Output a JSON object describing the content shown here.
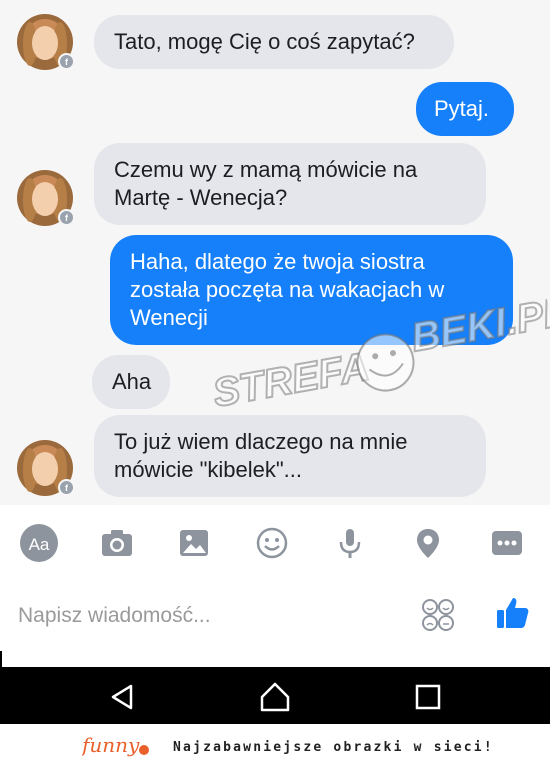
{
  "messages": [
    {
      "side": "in",
      "text": "Tato, mogę Cię o coś zapytać?"
    },
    {
      "side": "out",
      "text": "Pytaj."
    },
    {
      "side": "in",
      "text": "Czemu wy z mamą mówicie na Martę - Wenecja?"
    },
    {
      "side": "out",
      "text": "Haha, dlatego że twoja siostra została poczęta na wakacjach w Wenecji"
    },
    {
      "side": "in",
      "text": "Aha"
    },
    {
      "side": "in",
      "text": "To już wiem dlaczego na mnie mówicie \"kibelek\"..."
    }
  ],
  "watermark": {
    "left_text": "STREFA",
    "right_text": "BEKI.PL"
  },
  "toolbar": {
    "items": [
      {
        "icon": "text-format-icon",
        "label": "Aa"
      },
      {
        "icon": "camera-icon"
      },
      {
        "icon": "image-icon"
      },
      {
        "icon": "emoji-icon"
      },
      {
        "icon": "microphone-icon"
      },
      {
        "icon": "location-pin-icon"
      },
      {
        "icon": "more-icon"
      }
    ]
  },
  "composer": {
    "placeholder": "Napisz wiadomość..."
  },
  "navbar": {
    "items": [
      "back-triangle-icon",
      "home-icon",
      "recents-square-icon"
    ]
  },
  "footer": {
    "logo": "funny",
    "tagline": "Najzabawniejsze obrazki w sieci!"
  },
  "colors": {
    "outgoing": "#1680fb",
    "incoming": "#e4e6eb",
    "accent": "#1680fb"
  }
}
